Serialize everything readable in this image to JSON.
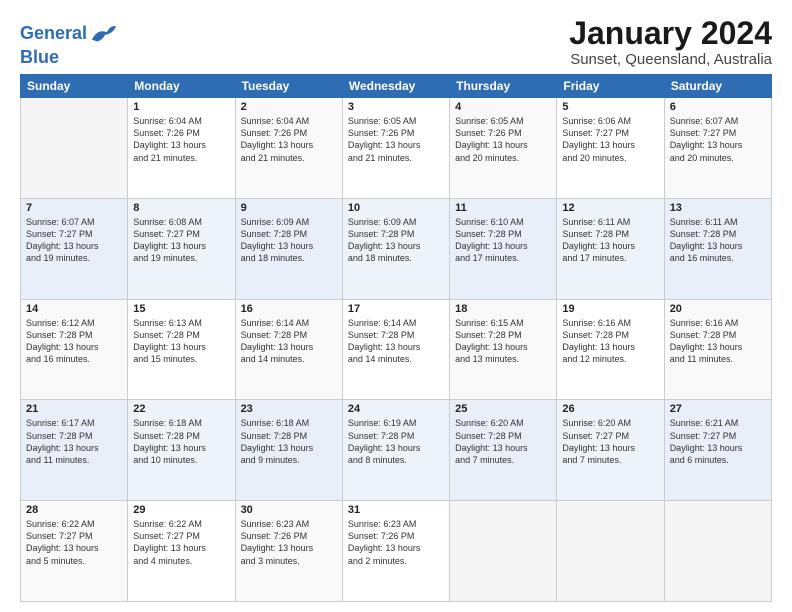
{
  "header": {
    "logo_line1": "General",
    "logo_line2": "Blue",
    "title": "January 2024",
    "subtitle": "Sunset, Queensland, Australia"
  },
  "calendar": {
    "days_of_week": [
      "Sunday",
      "Monday",
      "Tuesday",
      "Wednesday",
      "Thursday",
      "Friday",
      "Saturday"
    ],
    "weeks": [
      [
        {
          "day": "",
          "info": ""
        },
        {
          "day": "1",
          "info": "Sunrise: 6:04 AM\nSunset: 7:26 PM\nDaylight: 13 hours\nand 21 minutes."
        },
        {
          "day": "2",
          "info": "Sunrise: 6:04 AM\nSunset: 7:26 PM\nDaylight: 13 hours\nand 21 minutes."
        },
        {
          "day": "3",
          "info": "Sunrise: 6:05 AM\nSunset: 7:26 PM\nDaylight: 13 hours\nand 21 minutes."
        },
        {
          "day": "4",
          "info": "Sunrise: 6:05 AM\nSunset: 7:26 PM\nDaylight: 13 hours\nand 20 minutes."
        },
        {
          "day": "5",
          "info": "Sunrise: 6:06 AM\nSunset: 7:27 PM\nDaylight: 13 hours\nand 20 minutes."
        },
        {
          "day": "6",
          "info": "Sunrise: 6:07 AM\nSunset: 7:27 PM\nDaylight: 13 hours\nand 20 minutes."
        }
      ],
      [
        {
          "day": "7",
          "info": "Sunrise: 6:07 AM\nSunset: 7:27 PM\nDaylight: 13 hours\nand 19 minutes."
        },
        {
          "day": "8",
          "info": "Sunrise: 6:08 AM\nSunset: 7:27 PM\nDaylight: 13 hours\nand 19 minutes."
        },
        {
          "day": "9",
          "info": "Sunrise: 6:09 AM\nSunset: 7:28 PM\nDaylight: 13 hours\nand 18 minutes."
        },
        {
          "day": "10",
          "info": "Sunrise: 6:09 AM\nSunset: 7:28 PM\nDaylight: 13 hours\nand 18 minutes."
        },
        {
          "day": "11",
          "info": "Sunrise: 6:10 AM\nSunset: 7:28 PM\nDaylight: 13 hours\nand 17 minutes."
        },
        {
          "day": "12",
          "info": "Sunrise: 6:11 AM\nSunset: 7:28 PM\nDaylight: 13 hours\nand 17 minutes."
        },
        {
          "day": "13",
          "info": "Sunrise: 6:11 AM\nSunset: 7:28 PM\nDaylight: 13 hours\nand 16 minutes."
        }
      ],
      [
        {
          "day": "14",
          "info": "Sunrise: 6:12 AM\nSunset: 7:28 PM\nDaylight: 13 hours\nand 16 minutes."
        },
        {
          "day": "15",
          "info": "Sunrise: 6:13 AM\nSunset: 7:28 PM\nDaylight: 13 hours\nand 15 minutes."
        },
        {
          "day": "16",
          "info": "Sunrise: 6:14 AM\nSunset: 7:28 PM\nDaylight: 13 hours\nand 14 minutes."
        },
        {
          "day": "17",
          "info": "Sunrise: 6:14 AM\nSunset: 7:28 PM\nDaylight: 13 hours\nand 14 minutes."
        },
        {
          "day": "18",
          "info": "Sunrise: 6:15 AM\nSunset: 7:28 PM\nDaylight: 13 hours\nand 13 minutes."
        },
        {
          "day": "19",
          "info": "Sunrise: 6:16 AM\nSunset: 7:28 PM\nDaylight: 13 hours\nand 12 minutes."
        },
        {
          "day": "20",
          "info": "Sunrise: 6:16 AM\nSunset: 7:28 PM\nDaylight: 13 hours\nand 11 minutes."
        }
      ],
      [
        {
          "day": "21",
          "info": "Sunrise: 6:17 AM\nSunset: 7:28 PM\nDaylight: 13 hours\nand 11 minutes."
        },
        {
          "day": "22",
          "info": "Sunrise: 6:18 AM\nSunset: 7:28 PM\nDaylight: 13 hours\nand 10 minutes."
        },
        {
          "day": "23",
          "info": "Sunrise: 6:18 AM\nSunset: 7:28 PM\nDaylight: 13 hours\nand 9 minutes."
        },
        {
          "day": "24",
          "info": "Sunrise: 6:19 AM\nSunset: 7:28 PM\nDaylight: 13 hours\nand 8 minutes."
        },
        {
          "day": "25",
          "info": "Sunrise: 6:20 AM\nSunset: 7:28 PM\nDaylight: 13 hours\nand 7 minutes."
        },
        {
          "day": "26",
          "info": "Sunrise: 6:20 AM\nSunset: 7:27 PM\nDaylight: 13 hours\nand 7 minutes."
        },
        {
          "day": "27",
          "info": "Sunrise: 6:21 AM\nSunset: 7:27 PM\nDaylight: 13 hours\nand 6 minutes."
        }
      ],
      [
        {
          "day": "28",
          "info": "Sunrise: 6:22 AM\nSunset: 7:27 PM\nDaylight: 13 hours\nand 5 minutes."
        },
        {
          "day": "29",
          "info": "Sunrise: 6:22 AM\nSunset: 7:27 PM\nDaylight: 13 hours\nand 4 minutes."
        },
        {
          "day": "30",
          "info": "Sunrise: 6:23 AM\nSunset: 7:26 PM\nDaylight: 13 hours\nand 3 minutes."
        },
        {
          "day": "31",
          "info": "Sunrise: 6:23 AM\nSunset: 7:26 PM\nDaylight: 13 hours\nand 2 minutes."
        },
        {
          "day": "",
          "info": ""
        },
        {
          "day": "",
          "info": ""
        },
        {
          "day": "",
          "info": ""
        }
      ]
    ]
  }
}
